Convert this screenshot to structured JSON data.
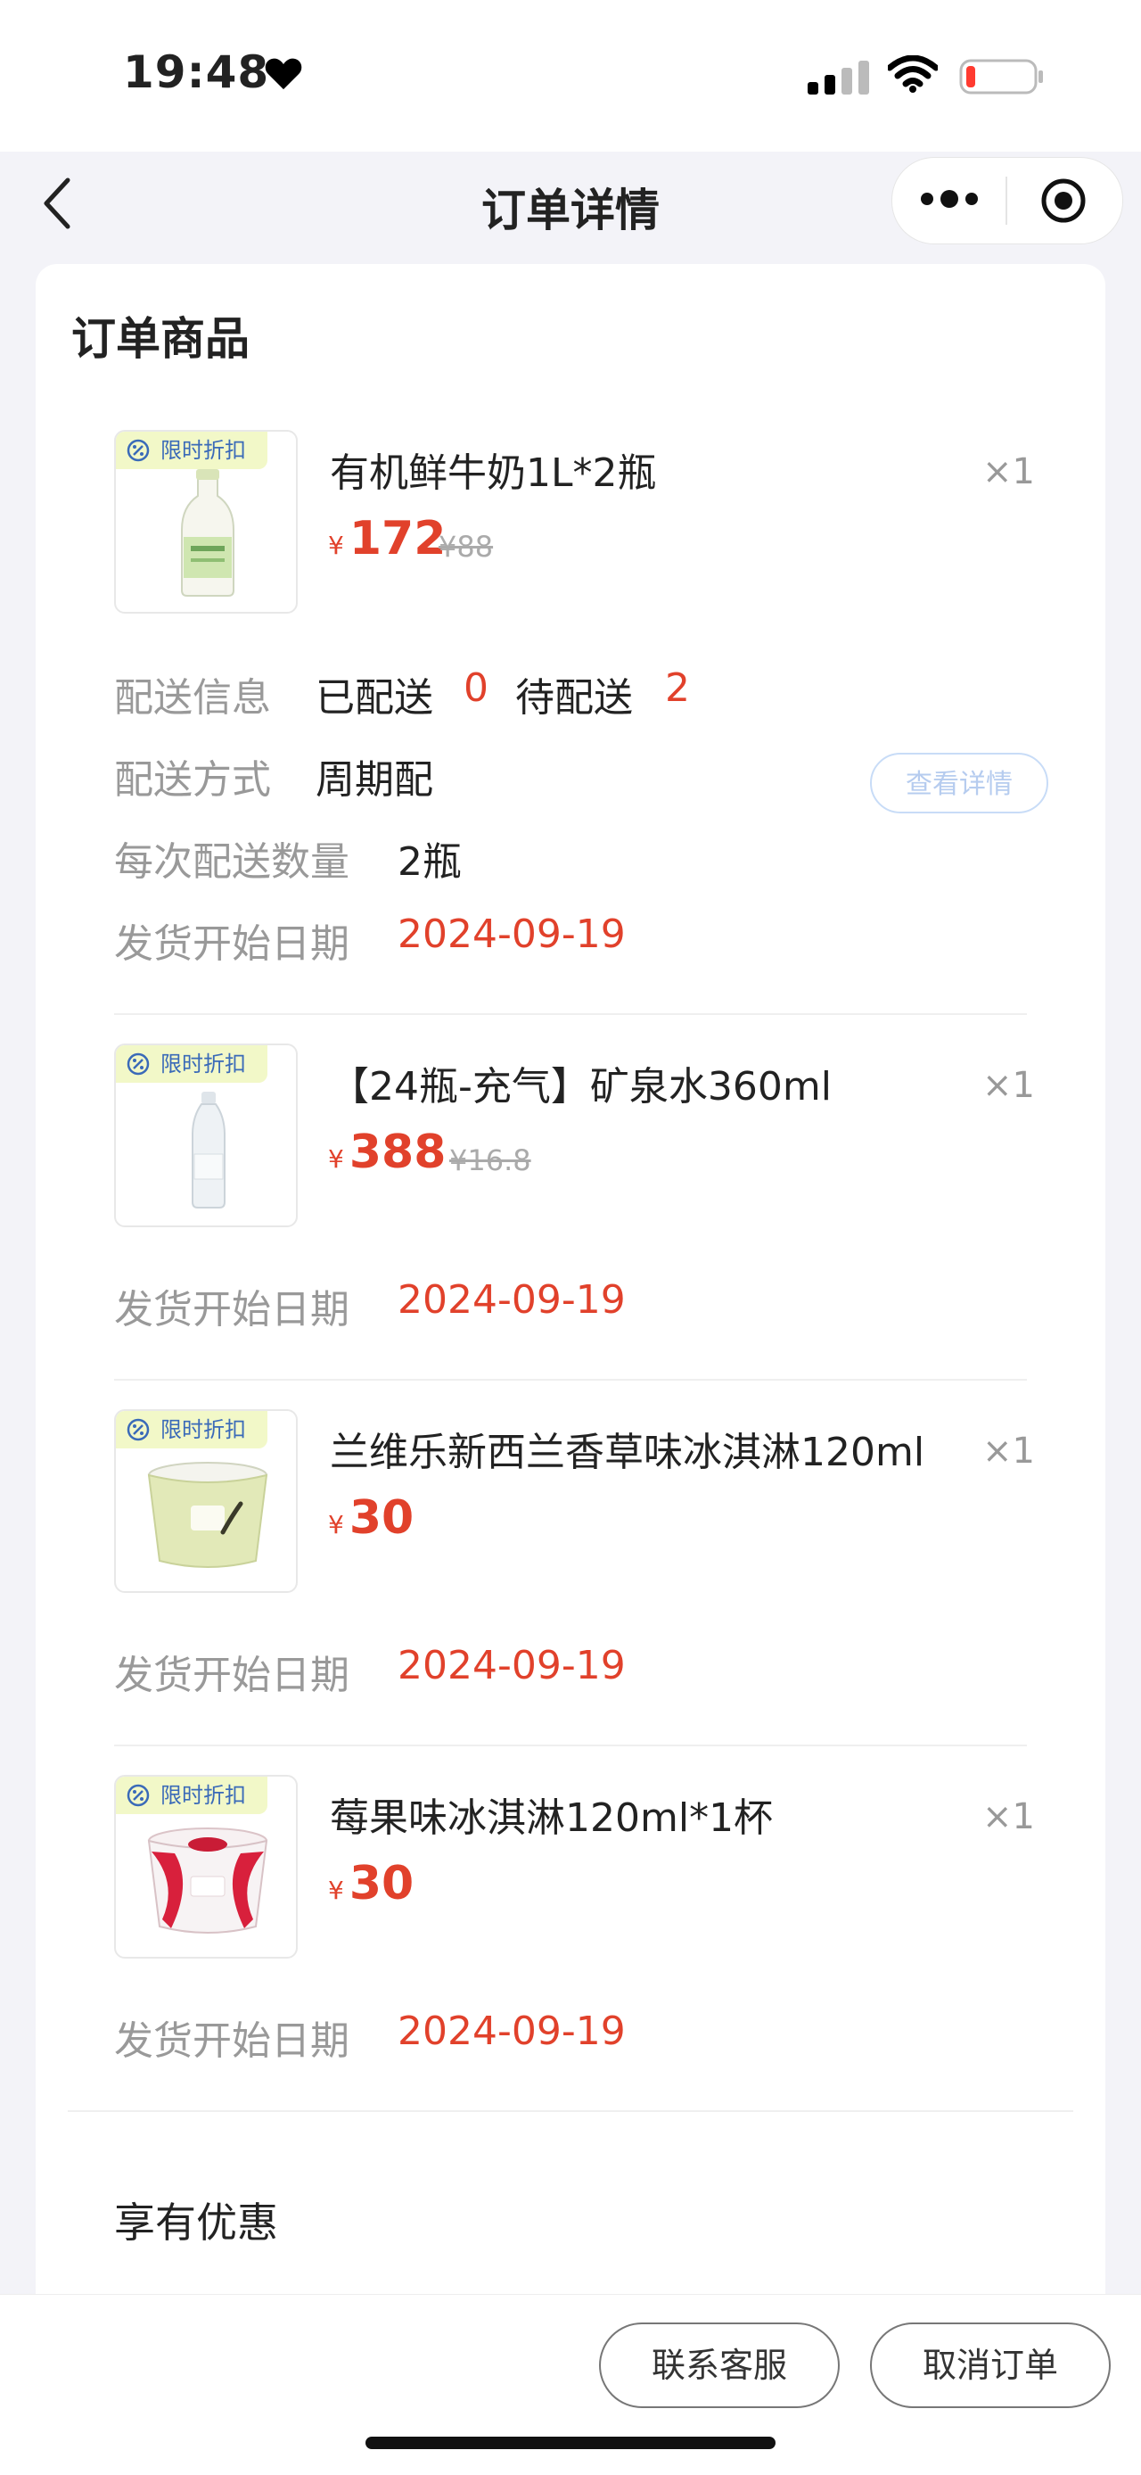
{
  "status_bar": {
    "time": "19:48"
  },
  "nav": {
    "title": "订单详情"
  },
  "section": {
    "title": "订单商品"
  },
  "badge_label": "限时折扣",
  "currency": "¥",
  "products": [
    {
      "name": "有机鲜牛奶1L*2瓶",
      "qty": "×1",
      "price": "172",
      "original_price": "¥88",
      "start_label": "发货开始日期",
      "start_date": "2024-09-19"
    },
    {
      "name": "【24瓶-充气】矿泉水360ml",
      "qty": "×1",
      "price": "388",
      "original_price": "¥16.8",
      "start_label": "发货开始日期",
      "start_date": "2024-09-19"
    },
    {
      "name": "兰维乐新西兰香草味冰淇淋120ml",
      "qty": "×1",
      "price": "30",
      "start_label": "发货开始日期",
      "start_date": "2024-09-19"
    },
    {
      "name": "莓果味冰淇淋120ml*1杯",
      "qty": "×1",
      "price": "30",
      "start_label": "发货开始日期",
      "start_date": "2024-09-19"
    }
  ],
  "delivery": {
    "info_label": "配送信息",
    "delivered_label": "已配送",
    "delivered_count": "0",
    "pending_label": "待配送",
    "pending_count": "2",
    "method_label": "配送方式",
    "method_value": "周期配",
    "per_label": "每次配送数量",
    "per_value": "2瓶",
    "details_button": "查看详情"
  },
  "benefit": {
    "title": "享有优惠"
  },
  "footer": {
    "contact_button": "联系客服",
    "cancel_button": "取消订单"
  },
  "colors": {
    "accent_red": "#e1412b",
    "badge_bg": "#f2f8c8",
    "badge_text": "#3a6ab8"
  }
}
